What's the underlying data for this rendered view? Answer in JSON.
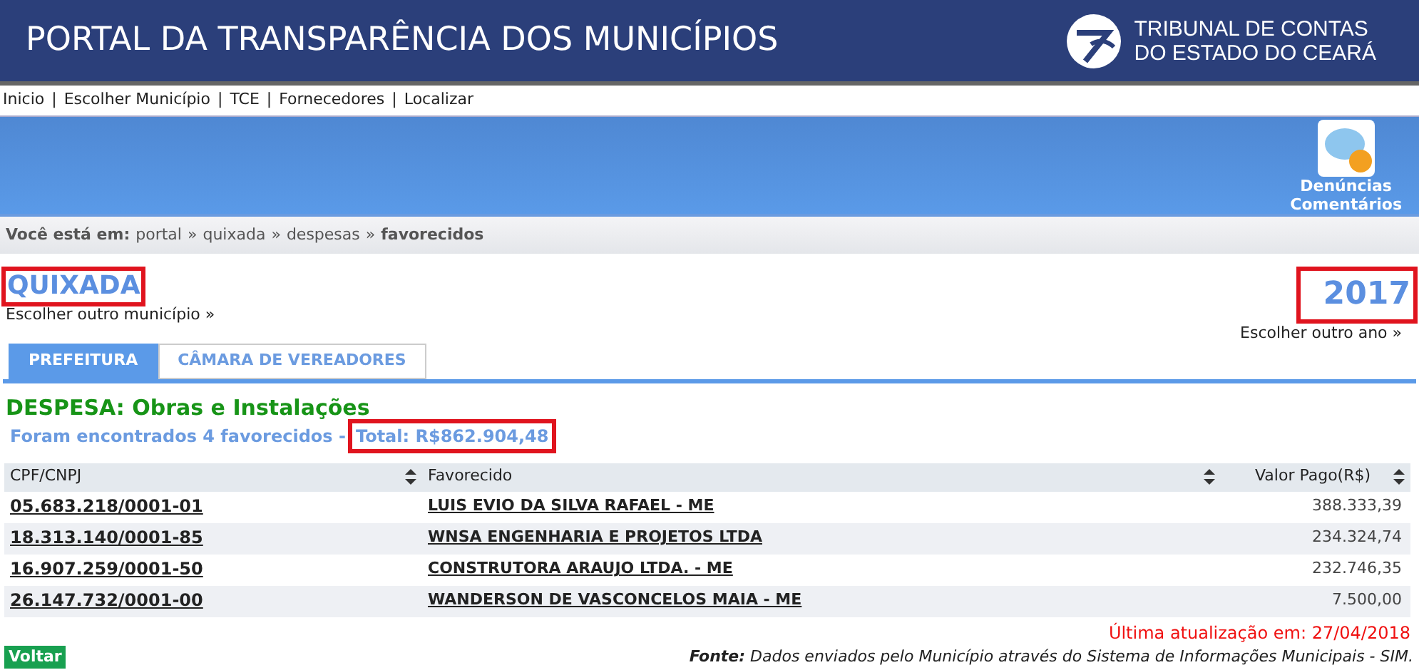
{
  "header": {
    "title": "PORTAL DA TRANSPARÊNCIA DOS MUNICÍPIOS",
    "logo_lines": [
      "TRIBUNAL DE CONTAS",
      "DO ESTADO DO CEARÁ"
    ]
  },
  "nav": [
    "Inicio",
    "Escolher Município",
    "TCE",
    "Fornecedores",
    "Localizar"
  ],
  "nav_separator": "|",
  "feedback": {
    "lines": [
      "Denúncias",
      "Comentários"
    ]
  },
  "breadcrumb": {
    "prefix": "Você está em:",
    "items": [
      {
        "label": "portal",
        "current": false
      },
      {
        "label": "quixada",
        "current": false
      },
      {
        "label": "despesas",
        "current": false
      },
      {
        "label": "favorecidos",
        "current": true
      }
    ],
    "separator": "»"
  },
  "municipality": {
    "name": "QUIXADA",
    "highlighted": true,
    "link": "Escolher outro município »"
  },
  "year": {
    "value": "2017",
    "highlighted": true,
    "link": "Escolher outro ano »"
  },
  "tabs": [
    {
      "label": "PREFEITURA",
      "selected": true
    },
    {
      "label": "CÂMARA DE VEREADORES",
      "selected": false
    }
  ],
  "expense_title": "DESPESA: Obras e Instalações",
  "found_text": "Foram encontrados 4 favorecidos -",
  "total": {
    "text": "Total: R$862.904,48",
    "highlighted": true
  },
  "table": {
    "columns": [
      "CPF/CNPJ",
      "Favorecido",
      "Valor Pago(R$)"
    ],
    "rows": [
      {
        "id": "05.683.218/0001-01",
        "name": "LUIS EVIO DA SILVA RAFAEL - ME",
        "value": "388.333,39"
      },
      {
        "id": "18.313.140/0001-85",
        "name": "WNSA ENGENHARIA E PROJETOS LTDA",
        "value": "234.324,74"
      },
      {
        "id": "16.907.259/0001-50",
        "name": "CONSTRUTORA ARAUJO LTDA. - ME",
        "value": "232.746,35"
      },
      {
        "id": "26.147.732/0001-00",
        "name": "WANDERSON DE VASCONCELOS MAIA - ME",
        "value": "7.500,00"
      }
    ]
  },
  "last_update": "Última atualização em: 27/04/2018",
  "back_button": "Voltar",
  "source": {
    "label": "Fonte:",
    "text": "Dados enviados pelo Município através do Sistema de Informações Municipais - SIM."
  }
}
